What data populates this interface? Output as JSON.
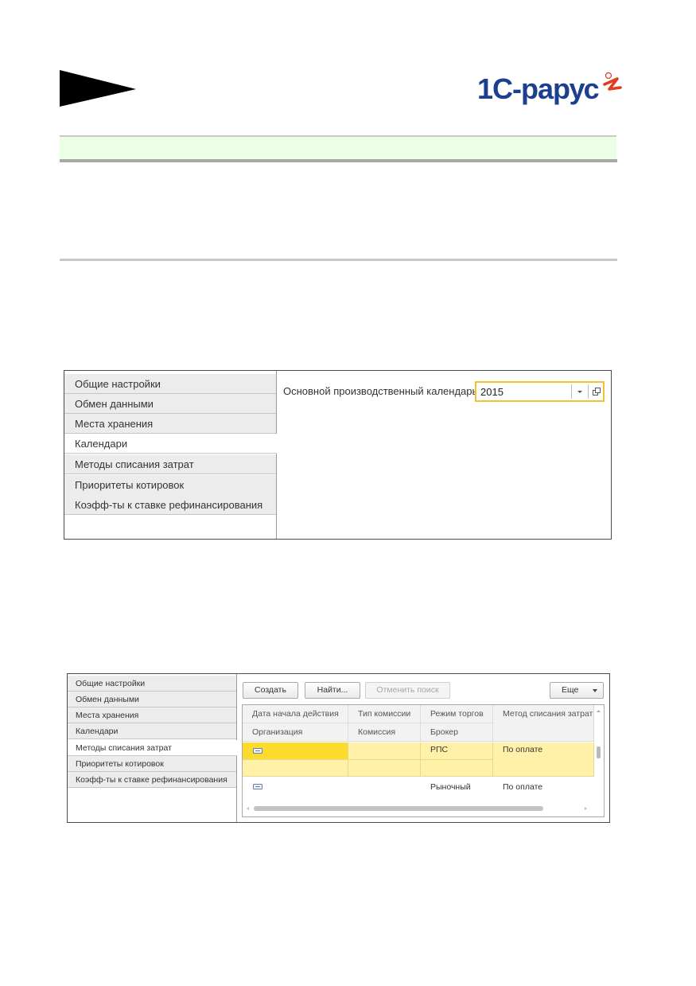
{
  "header": {
    "brand": "1С-рарус"
  },
  "shot1": {
    "tabs": [
      {
        "label": "Общие настройки"
      },
      {
        "label": "Обмен данными"
      },
      {
        "label": "Места хранения"
      },
      {
        "label": "Календари"
      },
      {
        "label": "Методы списания затрат"
      },
      {
        "label": "Приоритеты котировок"
      },
      {
        "label": "Коэфф-ты к ставке рефинансирования"
      }
    ],
    "active_tab": "Календари",
    "calendar_label": "Основной производственный календарь:",
    "calendar_value": "2015"
  },
  "shot2": {
    "tabs": [
      {
        "label": "Общие настройки"
      },
      {
        "label": "Обмен данными"
      },
      {
        "label": "Места хранения"
      },
      {
        "label": "Календари"
      },
      {
        "label": "Методы списания затрат"
      },
      {
        "label": "Приоритеты котировок"
      },
      {
        "label": "Коэфф-ты к ставке рефинансирования"
      }
    ],
    "active_tab": "Методы списания затрат",
    "toolbar": {
      "create": "Создать",
      "find": "Найти...",
      "cancel_search": "Отменить поиск",
      "more": "Еще"
    },
    "columns": {
      "row1": [
        "Дата начала действия",
        "Тип комиссии",
        "Режим торгов",
        "Метод списания затрат"
      ],
      "row2": [
        "Организация",
        "Комиссия",
        "Брокер"
      ]
    },
    "rows": [
      {
        "mode": "РПС",
        "method": "По оплате",
        "selected": true
      },
      {
        "mode": "Рыночный",
        "method": "По оплате",
        "selected": false
      }
    ]
  },
  "colors": {
    "band": "#eaffe4",
    "field_focus": "#f2c230",
    "row_selected": "#fff1a8",
    "cell_current": "#fadb2e"
  }
}
